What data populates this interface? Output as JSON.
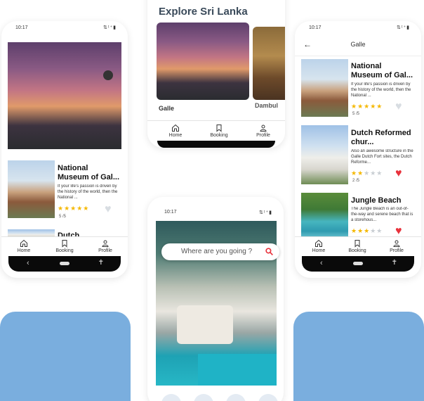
{
  "colors": {
    "accent_blue": "#7aaede",
    "heart_red": "#e8323c",
    "star_gold": "#f5b800"
  },
  "explore": {
    "title": "Explore Sri Lanka",
    "cards": [
      {
        "label": "Galle"
      },
      {
        "label": "Dambul"
      }
    ],
    "nav": {
      "home": "Home",
      "booking": "Booking",
      "profile": "Profile"
    }
  },
  "left_phone": {
    "time": "10:17",
    "status_icons": "⇅ᵗ⁺▮",
    "card": {
      "title": "National Museum of Gal...",
      "desc": "If your life's passion is driven by the history of the world, then the National ...",
      "stars": 5,
      "rating": "5 /5"
    },
    "next_title": "Dutch",
    "nav": {
      "home": "Home",
      "booking": "Booking",
      "profile": "Profile"
    }
  },
  "center_phone": {
    "time": "10:17",
    "status_icons": "⇅ᵗ⁺▮",
    "search": {
      "placeholder": "Where are you going ?"
    }
  },
  "right_phone": {
    "time": "10:17",
    "status_icons": "⇅ᵗ⁺▮",
    "header": {
      "title": "Galle"
    },
    "list": [
      {
        "title": "National Museum of Gal...",
        "desc": "If your life's passion is driven by the history of the world, then the National ...",
        "stars": 5,
        "rating": "5 /5",
        "favorite": false
      },
      {
        "title": "Dutch Reformed chur...",
        "desc": "Also an awesome structure in the Galle Dutch Fort sites, the Dutch Reforme...",
        "stars": 2,
        "rating": "2 /5",
        "favorite": true
      },
      {
        "title": "Jungle Beach",
        "desc": "The Jungle Beach is an out-of-the-way and serene beach that is a storehous...",
        "stars": 3,
        "rating": "3 /5",
        "favorite": true
      }
    ],
    "nav": {
      "home": "Home",
      "booking": "Booking",
      "profile": "Profile"
    }
  }
}
